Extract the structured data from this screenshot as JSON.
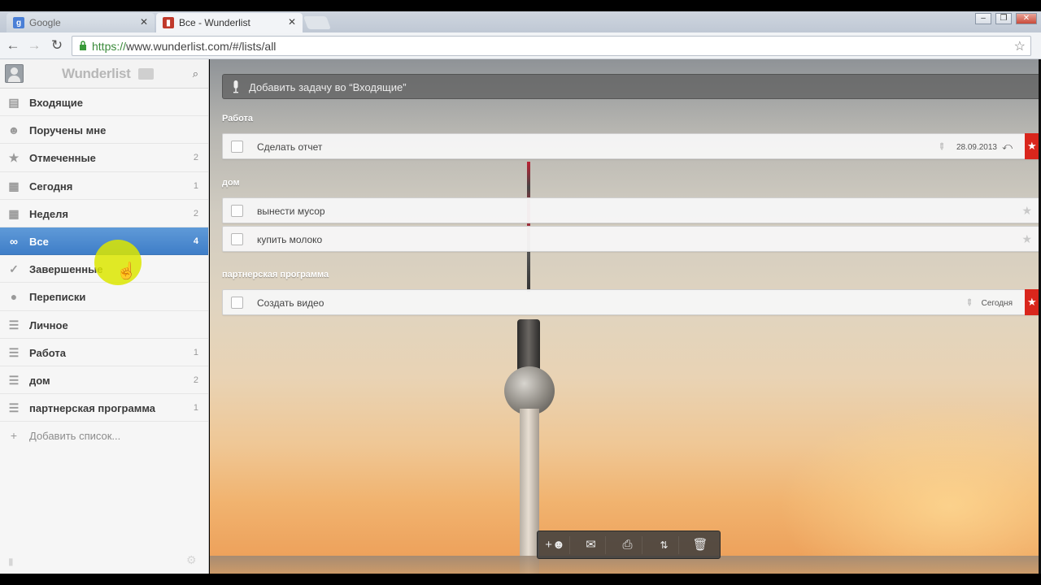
{
  "browser": {
    "tabs": [
      {
        "label": "Google",
        "favicon": "google-icon"
      },
      {
        "label": "Все - Wunderlist",
        "favicon": "wunderlist-icon"
      }
    ],
    "url_scheme": "https://",
    "url_rest": "www.wunderlist.com/#/lists/all"
  },
  "sidebar": {
    "logo": "Wunderlist",
    "items": [
      {
        "label": "Входящие",
        "count": "",
        "icon": "inbox-icon"
      },
      {
        "label": "Поручены мне",
        "count": "",
        "icon": "assigned-icon"
      },
      {
        "label": "Отмеченные",
        "count": "2",
        "icon": "star-icon"
      },
      {
        "label": "Сегодня",
        "count": "1",
        "icon": "calendar-day-icon"
      },
      {
        "label": "Неделя",
        "count": "2",
        "icon": "calendar-week-icon"
      },
      {
        "label": "Все",
        "count": "4",
        "icon": "infinity-icon",
        "active": true
      },
      {
        "label": "Завершенные",
        "count": "",
        "icon": "checkmark-icon"
      },
      {
        "label": "Переписки",
        "count": "",
        "icon": "speech-bubble-icon"
      },
      {
        "label": "Личное",
        "count": "",
        "icon": "list-icon"
      },
      {
        "label": "Работа",
        "count": "1",
        "icon": "list-icon"
      },
      {
        "label": "дом",
        "count": "2",
        "icon": "list-icon"
      },
      {
        "label": "партнерская программа",
        "count": "1",
        "icon": "list-icon"
      }
    ],
    "add_list": "Добавить список..."
  },
  "main": {
    "add_task_placeholder": "Добавить задачу во “Входящие”",
    "sections": [
      {
        "title": "Работа",
        "tasks": [
          {
            "title": "Сделать отчет",
            "due": "28.09.2013",
            "starred": true,
            "recurring": true
          }
        ]
      },
      {
        "title": "дом",
        "tasks": [
          {
            "title": "вынести мусор",
            "due": "",
            "starred": false
          },
          {
            "title": "купить молоко",
            "due": "",
            "starred": false
          }
        ]
      },
      {
        "title": "партнерская программа",
        "tasks": [
          {
            "title": "Создать видео",
            "due": "Сегодня",
            "starred": true
          }
        ]
      }
    ],
    "toolbar": [
      "share-list-icon",
      "email-icon",
      "print-icon",
      "sort-icon",
      "trash-icon"
    ]
  },
  "colors": {
    "active_item": "#4a8acd",
    "star_flag": "#d9261c"
  }
}
